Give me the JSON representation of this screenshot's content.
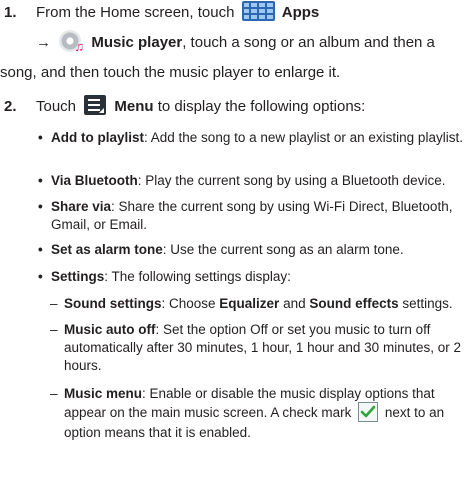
{
  "step1": {
    "number": "1.",
    "line1_prefix": "From the Home screen, touch",
    "apps_label": "Apps",
    "arrow": "→",
    "music_player_label": "Music player",
    "line2_suffix": ", touch a song or an album and then a",
    "line3": "song, and then touch the music player to enlarge it.",
    "icons": [
      "apps-grid-icon",
      "music-player-icon"
    ]
  },
  "step2": {
    "number": "2.",
    "prefix": "Touch",
    "menu_label": "Menu",
    "suffix": " to display the following options:",
    "icon": "menu-icon"
  },
  "options": [
    {
      "title": "Add to playlist",
      "desc": ": Add the song to a new playlist or an existing playlist."
    },
    {
      "title": "Via Bluetooth",
      "desc": ": Play the current song by using a Bluetooth device."
    },
    {
      "title": "Share via",
      "desc": ": Share the current song by using Wi-Fi Direct, Bluetooth, Gmail, or Email."
    },
    {
      "title": "Set as alarm tone",
      "desc": ": Use the current song as an alarm tone."
    },
    {
      "title": "Settings",
      "desc": ": The following settings display:"
    }
  ],
  "settings": [
    {
      "title": "Sound settings",
      "desc_a": ": Choose ",
      "bold_a": "Equalizer",
      "desc_b": " and ",
      "bold_b": "Sound effects",
      "desc_c": " settings."
    },
    {
      "title": "Music auto off",
      "desc": ": Set the option Off or set you music to turn off automatically after 30 minutes, 1 hour, 1 hour and 30 minutes, or 2 hours."
    },
    {
      "title": "Music menu",
      "desc_a": ": Enable or disable the music display options that appear on the main music screen. A check mark ",
      "desc_b": " next to an option means that it is enabled.",
      "icon": "check-mark-icon"
    }
  ],
  "bullet_char": "•",
  "dash_char": "–"
}
